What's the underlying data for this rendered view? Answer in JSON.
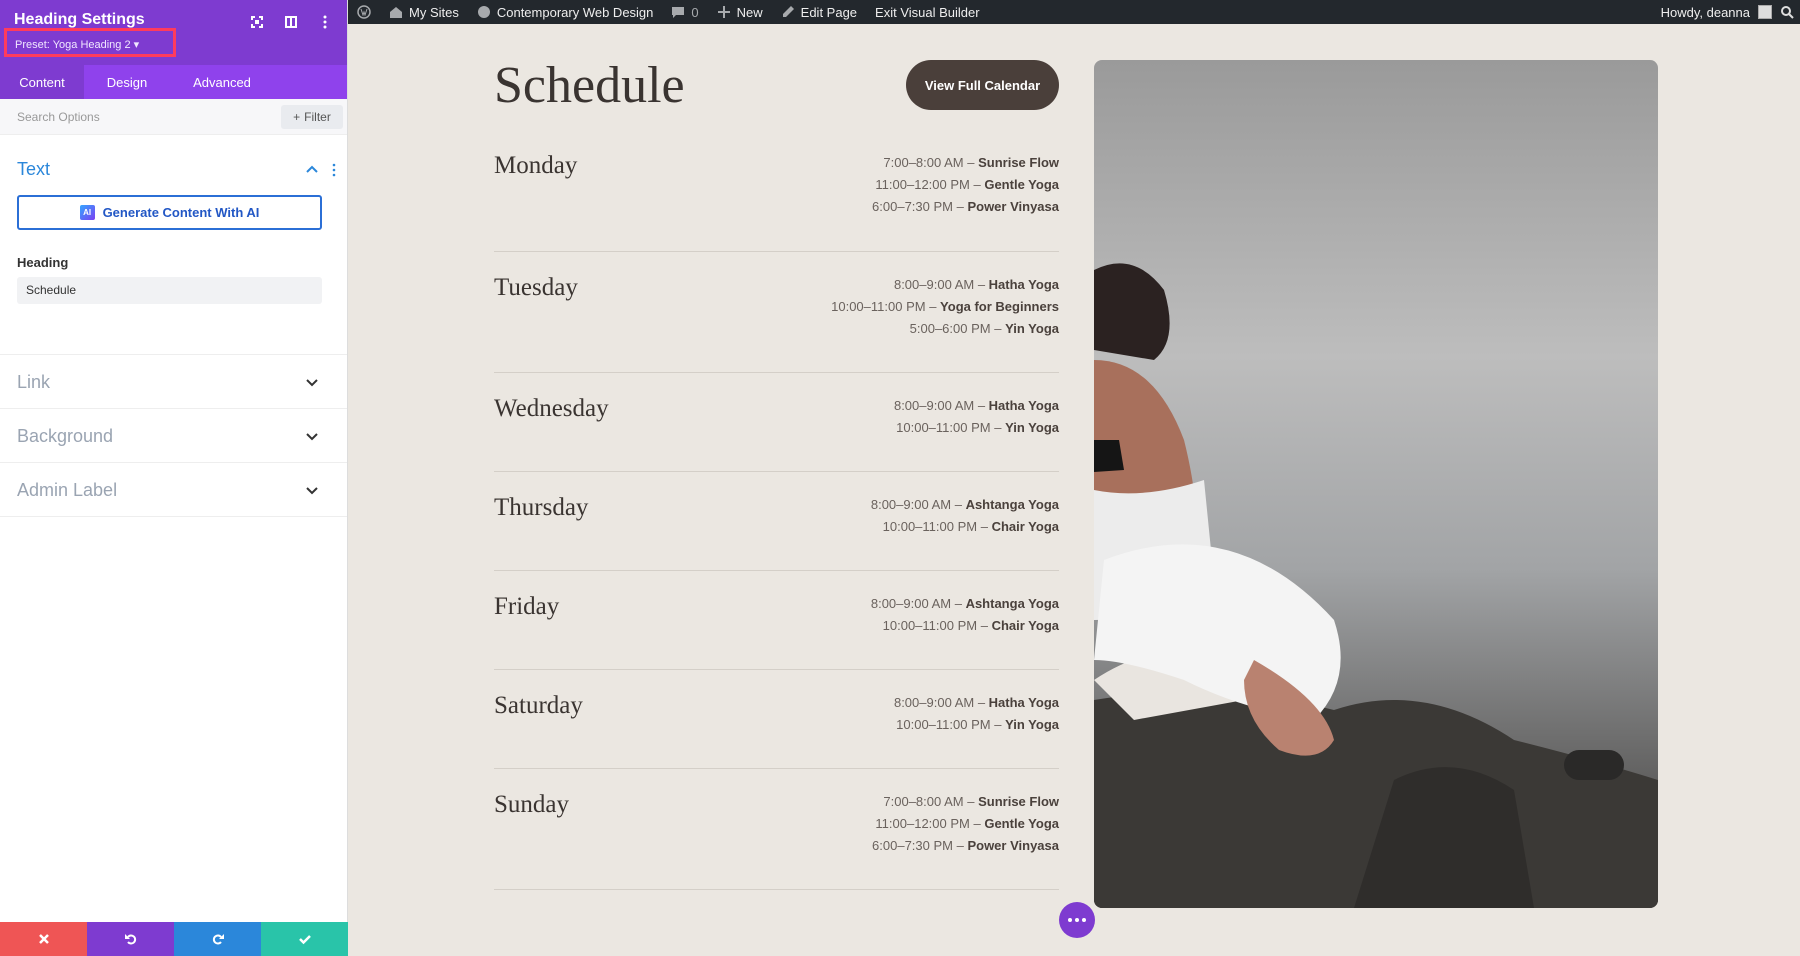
{
  "panel": {
    "title": "Heading Settings",
    "preset": "Preset: Yoga Heading 2 ▾",
    "tabs": [
      {
        "label": "Content",
        "active": true
      },
      {
        "label": "Design",
        "active": false
      },
      {
        "label": "Advanced",
        "active": false
      }
    ],
    "search_placeholder": "Search Options",
    "filter_label": "Filter",
    "text_section": {
      "title": "Text",
      "ai_button": "Generate Content With AI",
      "ai_badge": "AI",
      "field_label": "Heading",
      "field_value": "Schedule"
    },
    "collapsed_sections": [
      "Link",
      "Background",
      "Admin Label"
    ],
    "footer_colors": [
      "#ef5555",
      "#7e3bd0",
      "#2b87da",
      "#29c4a9"
    ]
  },
  "adminbar": {
    "my_sites": "My Sites",
    "site_name": "Contemporary Web Design",
    "comments": "0",
    "new": "New",
    "edit_page": "Edit Page",
    "exit_builder": "Exit Visual Builder",
    "howdy": "Howdy, deanna"
  },
  "page": {
    "heading": "Schedule",
    "calendar_button": "View Full Calendar",
    "days": [
      {
        "name": "Monday",
        "classes": [
          {
            "time": "7:00–8:00 AM",
            "name": "Sunrise Flow"
          },
          {
            "time": "11:00–12:00 PM",
            "name": "Gentle Yoga"
          },
          {
            "time": "6:00–7:30 PM",
            "name": "Power Vinyasa"
          }
        ]
      },
      {
        "name": "Tuesday",
        "classes": [
          {
            "time": "8:00–9:00 AM",
            "name": "Hatha Yoga"
          },
          {
            "time": "10:00–11:00 PM",
            "name": "Yoga for Beginners"
          },
          {
            "time": "5:00–6:00 PM",
            "name": "Yin Yoga"
          }
        ]
      },
      {
        "name": "Wednesday",
        "classes": [
          {
            "time": "8:00–9:00 AM",
            "name": "Hatha Yoga"
          },
          {
            "time": "10:00–11:00 PM",
            "name": "Yin Yoga"
          }
        ]
      },
      {
        "name": "Thursday",
        "classes": [
          {
            "time": "8:00–9:00 AM",
            "name": "Ashtanga Yoga"
          },
          {
            "time": "10:00–11:00 PM",
            "name": "Chair Yoga"
          }
        ]
      },
      {
        "name": "Friday",
        "classes": [
          {
            "time": "8:00–9:00 AM",
            "name": "Ashtanga Yoga"
          },
          {
            "time": "10:00–11:00 PM",
            "name": "Chair Yoga"
          }
        ]
      },
      {
        "name": "Saturday",
        "classes": [
          {
            "time": "8:00–9:00 AM",
            "name": "Hatha Yoga"
          },
          {
            "time": "10:00–11:00 PM",
            "name": "Yin Yoga"
          }
        ]
      },
      {
        "name": "Sunday",
        "classes": [
          {
            "time": "7:00–8:00 AM",
            "name": "Sunrise Flow"
          },
          {
            "time": "11:00–12:00 PM",
            "name": "Gentle Yoga"
          },
          {
            "time": "6:00–7:30 PM",
            "name": "Power Vinyasa"
          }
        ]
      }
    ]
  }
}
